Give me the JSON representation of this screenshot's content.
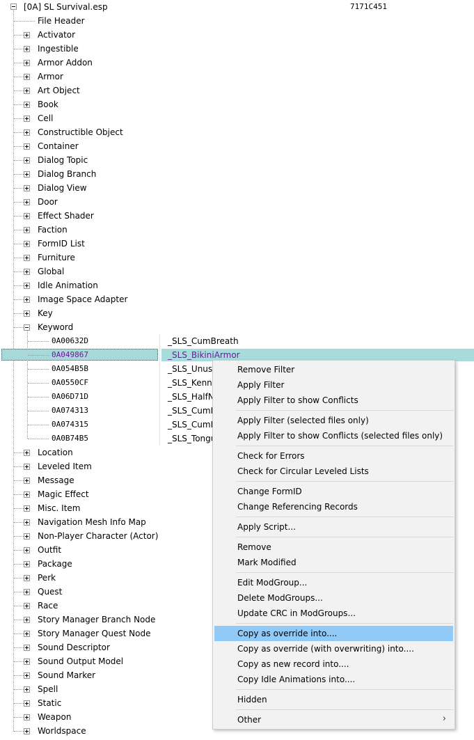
{
  "root": {
    "label": "[0A] SL Survival.esp",
    "value": "7171C451"
  },
  "groups_top": [
    {
      "label": "File Header",
      "expandable": false
    },
    {
      "label": "Activator",
      "expandable": true
    },
    {
      "label": "Ingestible",
      "expandable": true
    },
    {
      "label": "Armor Addon",
      "expandable": true
    },
    {
      "label": "Armor",
      "expandable": true
    },
    {
      "label": "Art Object",
      "expandable": true
    },
    {
      "label": "Book",
      "expandable": true
    },
    {
      "label": "Cell",
      "expandable": true
    },
    {
      "label": "Constructible Object",
      "expandable": true
    },
    {
      "label": "Container",
      "expandable": true
    },
    {
      "label": "Dialog Topic",
      "expandable": true
    },
    {
      "label": "Dialog Branch",
      "expandable": true
    },
    {
      "label": "Dialog View",
      "expandable": true
    },
    {
      "label": "Door",
      "expandable": true
    },
    {
      "label": "Effect Shader",
      "expandable": true
    },
    {
      "label": "Faction",
      "expandable": true
    },
    {
      "label": "FormID List",
      "expandable": true
    },
    {
      "label": "Furniture",
      "expandable": true
    },
    {
      "label": "Global",
      "expandable": true
    },
    {
      "label": "Idle Animation",
      "expandable": true
    },
    {
      "label": "Image Space Adapter",
      "expandable": true
    },
    {
      "label": "Key",
      "expandable": true
    }
  ],
  "keyword_group": {
    "label": "Keyword"
  },
  "keywords": [
    {
      "formid": "0A00632D",
      "edid": "_SLS_CumBreath"
    },
    {
      "formid": "0A049867",
      "edid": "_SLS_BikiniArmor",
      "selected": true
    },
    {
      "formid": "0A054B5B",
      "edid": "_SLS_Unused"
    },
    {
      "formid": "0A0550CF",
      "edid": "_SLS_Kennel"
    },
    {
      "formid": "0A06D71D",
      "edid": "_SLS_HalfNa"
    },
    {
      "formid": "0A074313",
      "edid": "_SLS_CumEf"
    },
    {
      "formid": "0A074315",
      "edid": "_SLS_CumEf"
    },
    {
      "formid": "0A0B74B5",
      "edid": "_SLS_Tongue"
    }
  ],
  "groups_bottom": [
    {
      "label": "Location"
    },
    {
      "label": "Leveled Item"
    },
    {
      "label": "Message"
    },
    {
      "label": "Magic Effect"
    },
    {
      "label": "Misc. Item"
    },
    {
      "label": "Navigation Mesh Info Map"
    },
    {
      "label": "Non-Player Character (Actor)"
    },
    {
      "label": "Outfit"
    },
    {
      "label": "Package"
    },
    {
      "label": "Perk"
    },
    {
      "label": "Quest"
    },
    {
      "label": "Race"
    },
    {
      "label": "Story Manager Branch Node"
    },
    {
      "label": "Story Manager Quest Node"
    },
    {
      "label": "Sound Descriptor"
    },
    {
      "label": "Sound Output Model"
    },
    {
      "label": "Sound Marker"
    },
    {
      "label": "Spell"
    },
    {
      "label": "Static"
    },
    {
      "label": "Weapon"
    },
    {
      "label": "Worldspace"
    }
  ],
  "context_menu": {
    "groups": [
      [
        "Remove Filter",
        "Apply Filter",
        "Apply Filter to show Conflicts"
      ],
      [
        "Apply Filter (selected files only)",
        "Apply Filter to show Conflicts (selected files only)"
      ],
      [
        "Check for Errors",
        "Check for Circular Leveled Lists"
      ],
      [
        "Change FormID",
        "Change Referencing Records"
      ],
      [
        "Apply Script..."
      ],
      [
        "Remove",
        "Mark Modified"
      ],
      [
        "Edit ModGroup...",
        "Delete ModGroups...",
        "Update CRC in ModGroups..."
      ],
      [
        "Copy as override into....",
        "Copy as override (with overwriting) into....",
        "Copy as new record into....",
        "Copy Idle Animations into...."
      ],
      [
        "Hidden"
      ],
      [
        "Other"
      ]
    ],
    "highlighted": "Copy as override into....",
    "submenu_items": [
      "Other"
    ]
  },
  "colors": {
    "selection": "#a8dcdc",
    "selected_text": "#6a1b9a",
    "menu_highlight": "#91c9f7"
  }
}
